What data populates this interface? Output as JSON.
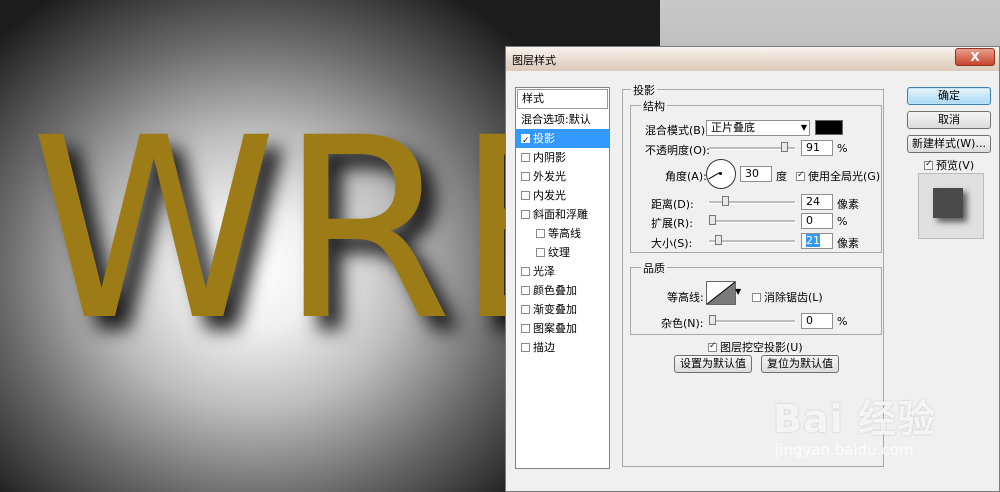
{
  "canvas": {
    "text": "WRE"
  },
  "dialog": {
    "title": "图层样式",
    "close_label": "X"
  },
  "style_list": {
    "header": "样式",
    "items": [
      {
        "label": "混合选项:默认",
        "has_checkbox": false,
        "checked": false,
        "sub": false,
        "selected": false
      },
      {
        "label": "投影",
        "has_checkbox": true,
        "checked": true,
        "sub": false,
        "selected": true
      },
      {
        "label": "内阴影",
        "has_checkbox": true,
        "checked": false,
        "sub": false,
        "selected": false
      },
      {
        "label": "外发光",
        "has_checkbox": true,
        "checked": false,
        "sub": false,
        "selected": false
      },
      {
        "label": "内发光",
        "has_checkbox": true,
        "checked": false,
        "sub": false,
        "selected": false
      },
      {
        "label": "斜面和浮雕",
        "has_checkbox": true,
        "checked": false,
        "sub": false,
        "selected": false
      },
      {
        "label": "等高线",
        "has_checkbox": true,
        "checked": false,
        "sub": true,
        "selected": false
      },
      {
        "label": "纹理",
        "has_checkbox": true,
        "checked": false,
        "sub": true,
        "selected": false
      },
      {
        "label": "光泽",
        "has_checkbox": true,
        "checked": false,
        "sub": false,
        "selected": false
      },
      {
        "label": "颜色叠加",
        "has_checkbox": true,
        "checked": false,
        "sub": false,
        "selected": false
      },
      {
        "label": "渐变叠加",
        "has_checkbox": true,
        "checked": false,
        "sub": false,
        "selected": false
      },
      {
        "label": "图案叠加",
        "has_checkbox": true,
        "checked": false,
        "sub": false,
        "selected": false
      },
      {
        "label": "描边",
        "has_checkbox": true,
        "checked": false,
        "sub": false,
        "selected": false
      }
    ]
  },
  "shadow": {
    "section_title": "投影",
    "structure": {
      "title": "结构",
      "blend_mode_label": "混合模式(B):",
      "blend_mode_value": "正片叠底",
      "blend_color": "#000000",
      "opacity_label": "不透明度(O):",
      "opacity_value": "91",
      "opacity_fraction": 0.91,
      "percent": "%",
      "angle_label": "角度(A):",
      "angle_value": "30",
      "angle_unit": "度",
      "global_light_label": "使用全局光(G)",
      "global_light_checked": true,
      "distance_label": "距离(D):",
      "distance_value": "24",
      "distance_fraction": 0.16,
      "px_unit": "像素",
      "spread_label": "扩展(R):",
      "spread_value": "0",
      "size_label": "大小(S):",
      "size_value": "21",
      "size_fraction": 0.08
    },
    "quality": {
      "title": "品质",
      "contour_label": "等高线:",
      "anti_alias_label": "消除锯齿(L)",
      "anti_alias_checked": false,
      "noise_label": "杂色(N):",
      "noise_value": "0",
      "percent": "%"
    },
    "knockout_label": "图层挖空投影(U)",
    "knockout_checked": true,
    "make_default_label": "设置为默认值",
    "reset_default_label": "复位为默认值"
  },
  "buttons": {
    "ok": "确定",
    "cancel": "取消",
    "new_style": "新建样式(W)...",
    "preview_label": "预览(V)",
    "preview_checked": true
  },
  "watermark": {
    "brand": "Bai 经验",
    "url": "jingyan.baidu.com"
  }
}
